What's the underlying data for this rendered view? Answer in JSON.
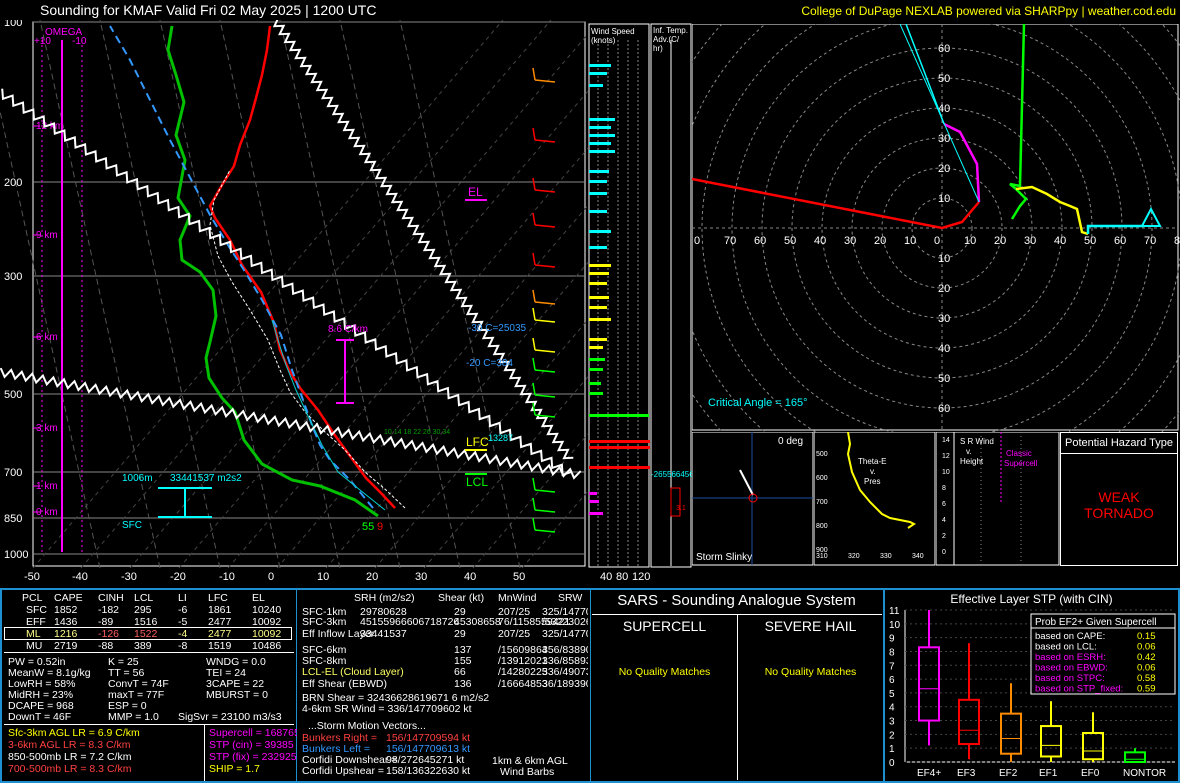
{
  "title": "Sounding for KMAF Valid  Fri 02 May 2025 | 1200 UTC",
  "credit": "College of DuPage NEXLAB powered via SHARPpy | weather.cod.edu",
  "skewt": {
    "pressure_ticks": [
      "100",
      "200",
      "300",
      "500",
      "700",
      "850",
      "1000"
    ],
    "temp_ticks": [
      "-50",
      "-40",
      "-30",
      "-20",
      "-10",
      "0",
      "10",
      "20",
      "30",
      "40",
      "50"
    ],
    "height_labels": [
      "12 km",
      "9 km",
      "6 km",
      "3 km",
      "1 km",
      "0 km"
    ],
    "omega_label": "OMEGA",
    "omega_ticks": [
      "+10",
      "-10"
    ],
    "el_label": "EL",
    "lfc_label": "LFC",
    "lcl_label": "LCL",
    "lapse_label": "8.6 C/km",
    "dgz_top": "-30 C=25035",
    "dgz_bot": "-20 C=384",
    "lfc_val": "13287",
    "eff_layer": "1006m",
    "eff_srh": "33441537 m2s2",
    "sfc_label": "SFC",
    "sfc_temp": "55",
    "sfc_dew": "9",
    "wetbulb_nums": "10  14  18  22  26 30 34"
  },
  "windspeed": {
    "label": "Wind Speed (knots)",
    "ticks": [
      "40",
      "80",
      "120"
    ]
  },
  "inftemp": {
    "label": "Inf. Temp. Adv.(C/hr)",
    "value": "-265566456",
    "bar": "3.1"
  },
  "hodograph": {
    "rings_y": [
      "60",
      "50",
      "40",
      "30",
      "20",
      "10"
    ],
    "rings_y_neg": [
      "10",
      "20",
      "30",
      "40",
      "50",
      "60"
    ],
    "axis_x": [
      "0",
      "70",
      "60",
      "50",
      "40",
      "30",
      "20",
      "10",
      "0",
      "10",
      "20",
      "30",
      "40",
      "50",
      "60",
      "70",
      "80"
    ],
    "critical_angle": "Critical Angle = 165°"
  },
  "slinky": {
    "deg": "0 deg",
    "label": "Storm Slinky"
  },
  "thetae": {
    "title": "Theta-E v. Pres",
    "p_ticks": [
      "500",
      "600",
      "700",
      "800",
      "900"
    ],
    "x_ticks": [
      "310",
      "320",
      "330",
      "340"
    ]
  },
  "srwind": {
    "title": "S R Wind v. Height",
    "classic": "Classic Supercell",
    "ticks": [
      "14",
      "12",
      "10",
      "8",
      "6",
      "4",
      "2",
      "0"
    ]
  },
  "hazard": {
    "title": "Potential Hazard Type",
    "value": "WEAK TORNADO"
  },
  "parcels": {
    "headers": [
      "PCL",
      "CAPE",
      "CINH",
      "LCL",
      "LI",
      "LFC",
      "EL"
    ],
    "rows": [
      [
        "SFC",
        "1852",
        "-182",
        "295",
        "-6",
        "1861",
        "10240"
      ],
      [
        "EFF",
        "1436",
        "-89",
        "1516",
        "-5",
        "2477",
        "10092"
      ],
      [
        "ML",
        "1216",
        "-126",
        "1522",
        "-4",
        "2477",
        "10092"
      ],
      [
        "MU",
        "2719",
        "-88",
        "389",
        "-8",
        "1519",
        "10486"
      ]
    ]
  },
  "indices": {
    "col1": [
      "PW = 0.52in",
      "MeanW = 8.1g/kg",
      "LowRH = 58%",
      "MidRH = 23%",
      "DCAPE = 968",
      "DownT = 46F"
    ],
    "col2": [
      "K = 25",
      "TT = 56",
      "ConvT = 74F",
      "maxT = 77F",
      "ESP = 0",
      "MMP = 1.0"
    ],
    "col3": [
      "WNDG = 0.0",
      "TEI = 24",
      "3CAPE = 22",
      "MBURST = 0",
      "",
      ""
    ],
    "sigsvr": "SigSvr = 23100 m3/s3"
  },
  "lapse": [
    "Sfc-3km AGL LR = 6.9 C/km",
    "3-6km AGL LR = 8.3 C/km",
    "850-500mb LR = 7.2 C/km",
    "700-500mb LR = 8.3 C/km"
  ],
  "composite": [
    "Supercell = 168765",
    "STP (cin) = 39385",
    "STP (fix) = 232925",
    "SHIP = 1.7"
  ],
  "kinematics": {
    "headers": [
      "SRH (m2/s2)",
      "Shear (kt)",
      "MnWind",
      "SRW"
    ],
    "rows": [
      [
        "SFC-1km",
        "29780628",
        "29",
        "207/25",
        "325/147709578"
      ],
      [
        "SFC-3km",
        "45155966606718726",
        "45308658",
        "76/1158559421",
        "/53223026"
      ],
      [
        "Eff Inflow Layer",
        "33441537",
        "29",
        "207/25",
        "325/147709578"
      ],
      [
        "SFC-6km",
        "",
        "137",
        "/15609864",
        "356/8389054"
      ],
      [
        "SFC-8km",
        "",
        "155",
        "/13912021",
        "336/8589376"
      ],
      [
        "LCL-EL (Cloud Layer)",
        "",
        "66",
        "/14280225",
        "336/4907339"
      ],
      [
        "Eff Shear (EBWD)",
        "",
        "136",
        "/16664853",
        "36/18939004"
      ]
    ],
    "brn": "BRN Shear = 32436628619671 6 m2/s2",
    "sr46": "4-6km SR Wind = 336/147709602 kt",
    "sm_title": "...Storm Motion Vectors...",
    "sm": [
      [
        "Bunkers Right =",
        "156/147709594 kt"
      ],
      [
        "Bunkers Left =",
        "156/147709613 kt"
      ],
      [
        "Corfidi Downshear =",
        "98/272645271 kt"
      ],
      [
        "Corfidi Upshear =",
        "158/136322630 kt"
      ]
    ],
    "barbs_label": "1km & 6km AGL Wind Barbs"
  },
  "sars": {
    "title": "SARS - Sounding Analogue System",
    "supercell": "SUPERCELL",
    "hail": "SEVERE HAIL",
    "sup_match": "No Quality Matches",
    "hail_match": "No Quality Matches"
  },
  "stp": {
    "title": "Effective Layer STP (with CIN)",
    "y_ticks": [
      "11",
      "10",
      "9",
      "8",
      "7",
      "6",
      "5",
      "4",
      "3",
      "2",
      "1",
      "0"
    ],
    "prob_title": "Prob EF2+ Given Supercell",
    "prob": [
      [
        "based on CAPE:",
        "0.15",
        "#ffffff"
      ],
      [
        "based on LCL:",
        "0.06",
        "#ffffff"
      ],
      [
        "based on ESRH:",
        "0.42",
        "#ff00ff"
      ],
      [
        "based on EBWD:",
        "0.06",
        "#ff00ff"
      ],
      [
        "based on STPC:",
        "0.58",
        "#ff00ff"
      ],
      [
        "based on STP_fixed:",
        "0.59",
        "#ff00ff"
      ]
    ],
    "categories": [
      "EF4+",
      "EF3",
      "EF2",
      "EF1",
      "EF0",
      "NONTOR"
    ],
    "boxes": [
      {
        "low": 1.2,
        "q1": 3.0,
        "med": 5.3,
        "q3": 8.3,
        "high": 11.0,
        "color": "#ff00ff"
      },
      {
        "low": 0.2,
        "q1": 1.3,
        "med": 2.3,
        "q3": 4.5,
        "high": 8.6,
        "color": "#ff0000"
      },
      {
        "low": 0.0,
        "q1": 0.6,
        "med": 1.7,
        "q3": 3.5,
        "high": 5.7,
        "color": "#ff8c00"
      },
      {
        "low": 0.0,
        "q1": 0.4,
        "med": 1.2,
        "q3": 2.6,
        "high": 4.4,
        "color": "#ffff00"
      },
      {
        "low": 0.0,
        "q1": 0.2,
        "med": 0.8,
        "q3": 2.1,
        "high": 3.6,
        "color": "#ffff00"
      },
      {
        "low": 0.0,
        "q1": 0.0,
        "med": 0.2,
        "q3": 0.7,
        "high": 1.0,
        "color": "#00ff00"
      }
    ]
  },
  "colors": {
    "frame": "#1e8fd0",
    "temp": "#ff0000",
    "dew": "#00c000",
    "parcel": "#ffffff",
    "virtual": "#3399ff",
    "omega": "#ff00ff"
  }
}
